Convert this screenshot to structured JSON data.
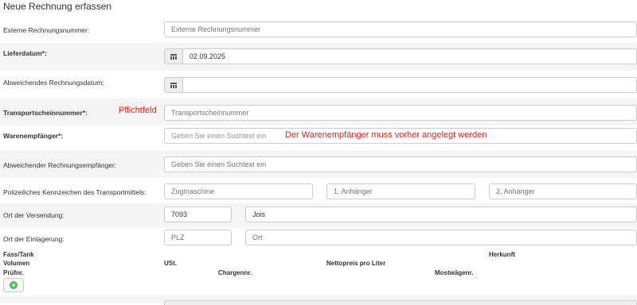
{
  "title": "Neue Rechnung erfassen",
  "fields": {
    "externe_nr": {
      "label": "Externe Rechnungsnummer:",
      "placeholder": "Externe Rechnungsnummer"
    },
    "lieferdatum": {
      "label": "Lieferdatum*:",
      "value": "02.09.2025",
      "icon": "calendar-icon"
    },
    "rechnungsdatum": {
      "label": "Abweichendes Rechnungsdatum:",
      "value": "",
      "icon": "calendar-icon"
    },
    "transportschein": {
      "label": "Transportscheinnummer*:",
      "placeholder": "Transportscheinnummer",
      "annotation": "Pflichtfeld"
    },
    "warenempfaenger": {
      "label": "Warenempfänger*:",
      "placeholder": "Geben Sie einen Suchtext ein",
      "annotation": "Der Warenempfänger muss vorher angelegt werden"
    },
    "rechnungsempfaenger": {
      "label": "Abweichender Rechnungsempfänger:",
      "placeholder": "Geben Sie einen Suchtext ein"
    },
    "kennzeichen": {
      "label": "Polizeiliches Kennzeichen des Transportmittels:",
      "placeholders": [
        "Zugmaschine",
        "1. Anhänger",
        "2. Anhänger"
      ]
    },
    "versendung": {
      "label": "Ort der Versendung:",
      "plz": "7093",
      "ort": "Jois"
    },
    "einlagerung": {
      "label": "Ort der Einlagerung:",
      "plz_placeholder": "PLZ",
      "ort_placeholder": "Ort"
    }
  },
  "table_headers": {
    "fass_tank": "Fass/Tank",
    "herkunft": "Herkunft",
    "volumen": "Volumen",
    "ust": "USt.",
    "nettopreis": "Nettopreis pro Liter",
    "pruefnr": "Prüfnr.",
    "chargennr": "Chargennr.",
    "mostwaegenr": "Mostwägenr."
  },
  "add_button": {
    "icon": "plus-circle-icon",
    "symbol": "+"
  },
  "colors": {
    "annotation": "#e02020",
    "add_icon": "#5cb85c"
  }
}
